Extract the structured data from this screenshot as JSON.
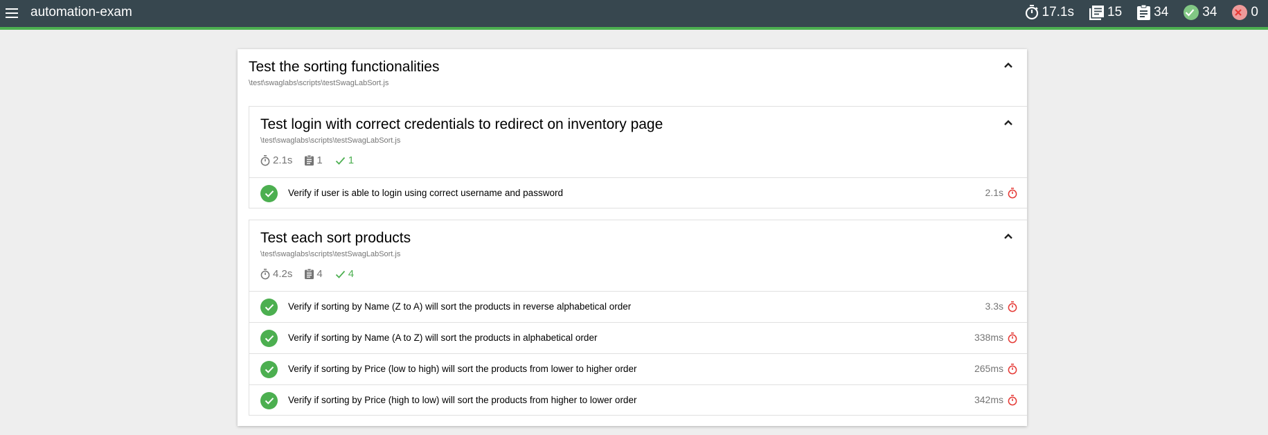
{
  "header": {
    "title": "automation-exam",
    "duration": "17.1s",
    "suites": "15",
    "tests": "34",
    "passes": "34",
    "failures": "0"
  },
  "suite": {
    "title": "Test the sorting functionalities",
    "path": "\\test\\swaglabs\\scripts\\testSwagLabSort.js",
    "subsuites": [
      {
        "title": "Test login with correct credentials to redirect on inventory page",
        "path": "\\test\\swaglabs\\scripts\\testSwagLabSort.js",
        "duration": "2.1s",
        "tests": "1",
        "passes": "1",
        "items": [
          {
            "title": "Verify if user is able to login using correct username and password",
            "duration": "2.1s"
          }
        ]
      },
      {
        "title": "Test each sort products",
        "path": "\\test\\swaglabs\\scripts\\testSwagLabSort.js",
        "duration": "4.2s",
        "tests": "4",
        "passes": "4",
        "items": [
          {
            "title": "Verify if sorting by Name (Z to A) will sort the products in reverse alphabetical order",
            "duration": "3.3s"
          },
          {
            "title": "Verify if sorting by Name (A to Z) will sort the products in alphabetical order",
            "duration": "338ms"
          },
          {
            "title": "Verify if sorting by Price (low to high) will sort the products from lower to higher order",
            "duration": "265ms"
          },
          {
            "title": "Verify if sorting by Price (high to low) will sort the products from higher to lower order",
            "duration": "342ms"
          }
        ]
      }
    ]
  },
  "colors": {
    "topbar": "#37474f",
    "accent_pass": "#4caf50",
    "duration_icon": "#e53935"
  },
  "icons": {
    "menu": "hamburger-menu-icon",
    "duration": "stopwatch-icon",
    "suites": "library-books-icon",
    "tests": "clipboard-icon",
    "passes": "check-circle-icon",
    "failures": "cancel-circle-icon",
    "collapse": "chevron-up-icon"
  }
}
